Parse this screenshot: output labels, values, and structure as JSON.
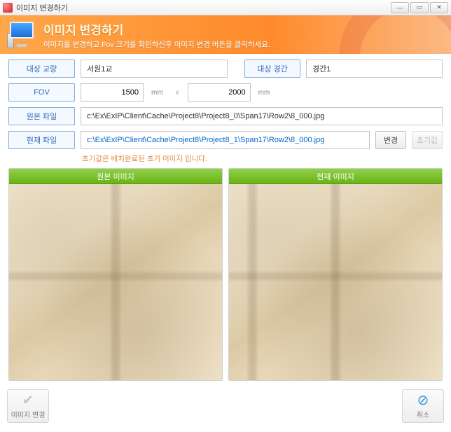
{
  "window": {
    "title": "이미지 변경하기"
  },
  "header": {
    "title": "이미지 변경하기",
    "subtitle": "이미지를 변경하고 Fov 크기를 확인하신후 이미지 변경 버튼을 클릭하세요."
  },
  "labels": {
    "target_bridge": "대상 교량",
    "target_span": "대상 경간",
    "fov": "FOV",
    "original_file": "원본 파일",
    "current_file": "현재 파일",
    "change": "변경",
    "reset": "초기값",
    "original_image": "원본 이미지",
    "current_image": "현재 이미지"
  },
  "values": {
    "target_bridge": "서원1교",
    "target_span": "경간1",
    "fov_w": "1500",
    "fov_h": "2000",
    "unit": "mm",
    "mult": "x",
    "original_file": "c:\\Ex\\ExIP\\Client\\Cache\\Project8\\Project8_0\\Span17\\Row2\\8_000.jpg",
    "current_file": "c:\\Ex\\ExIP\\Client\\Cache\\Project8\\Project8_1\\Span17\\Row2\\8_000.jpg"
  },
  "hint": "초기값은 배치완료된 초기 이미지 입니다.",
  "footer": {
    "apply": "이미지 변경",
    "cancel": "취소"
  }
}
